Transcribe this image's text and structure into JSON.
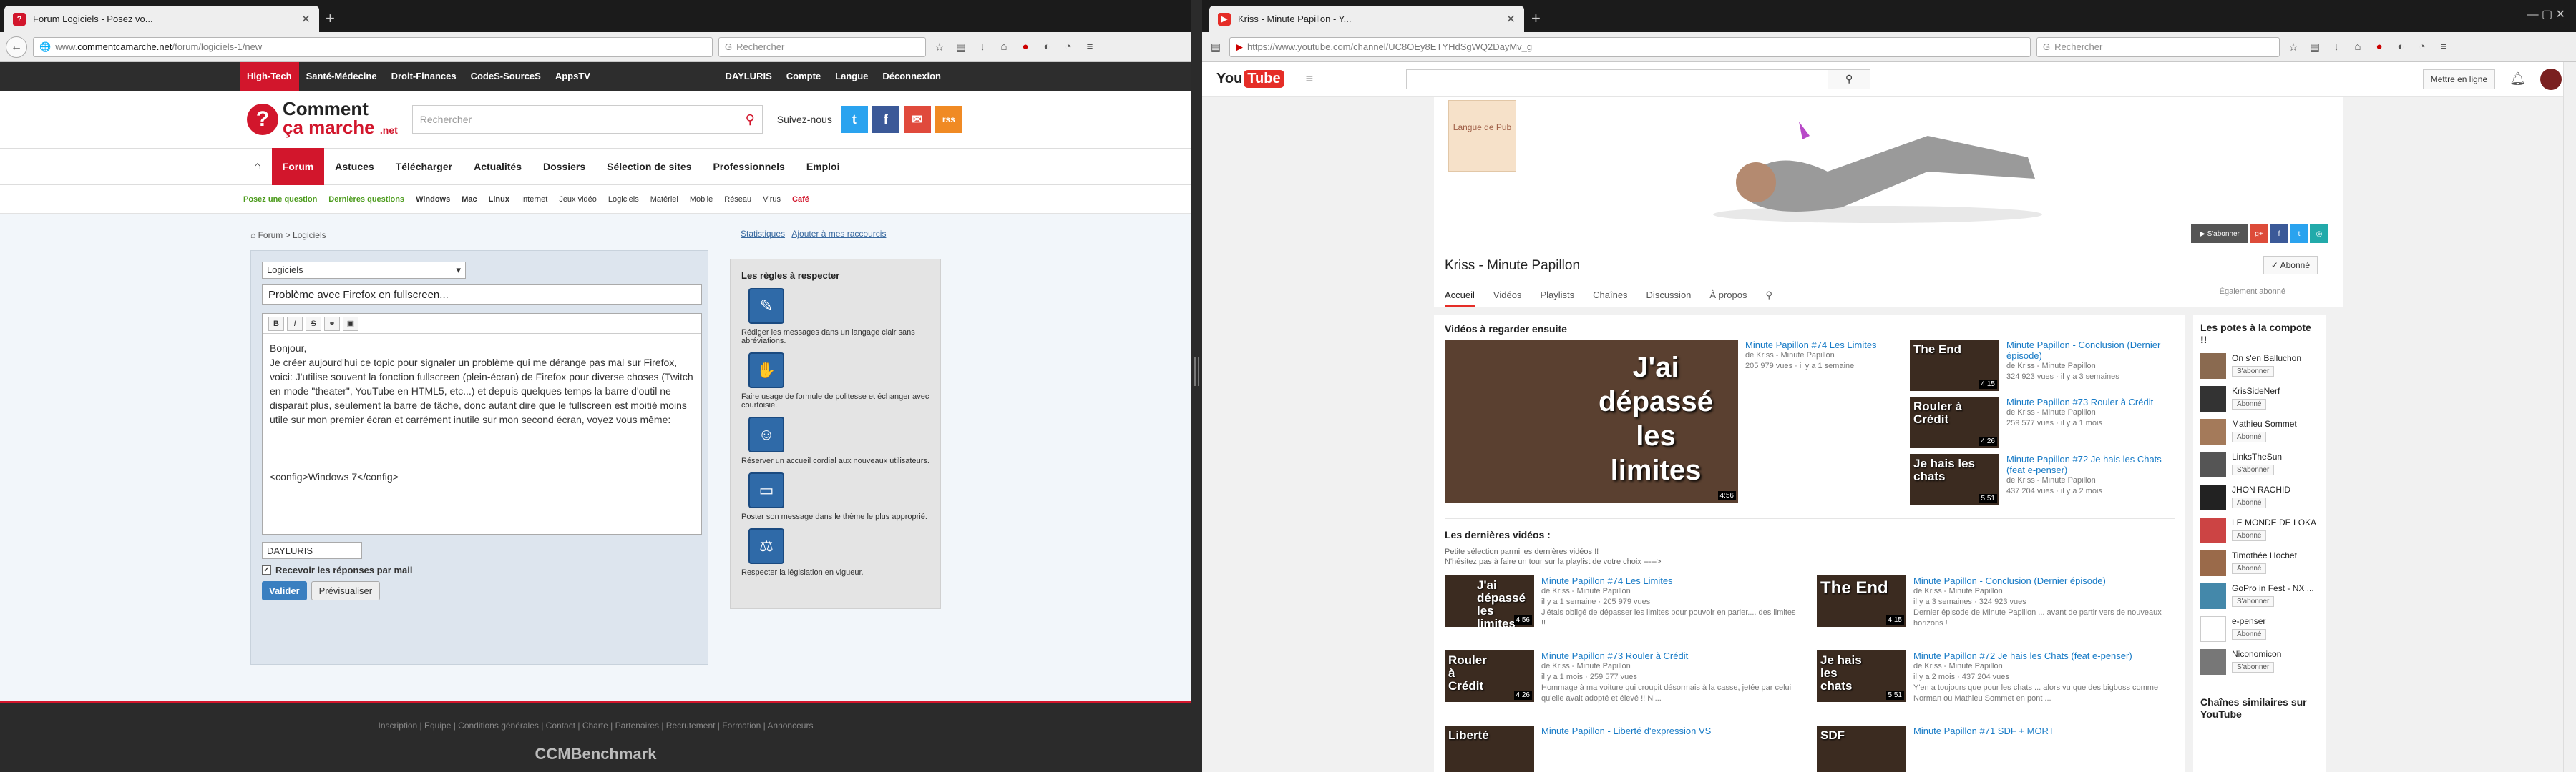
{
  "left": {
    "tab_title": "Forum Logiciels - Posez vo...",
    "url_prefix": "www.",
    "url_domain": "commentcamarche.net",
    "url_path": "/forum/logiciels-1/new",
    "search_placeholder": "Rechercher",
    "topnav": [
      "High-Tech",
      "Santé-Médecine",
      "Droit-Finances",
      "CodeS-SourceS",
      "AppsTV"
    ],
    "topnav_right": [
      "DAYLURIS",
      "Compte",
      "Langue",
      "Déconnexion"
    ],
    "logo_line1": "Comment",
    "logo_line2": "ça marche",
    "logo_net": ".net",
    "site_search_placeholder": "Rechercher",
    "follow": "Suivez-nous",
    "social": [
      "t",
      "f",
      "✉",
      "rss"
    ],
    "menu": [
      "Forum",
      "Astuces",
      "Télécharger",
      "Actualités",
      "Dossiers",
      "Sélection de sites",
      "Professionnels",
      "Emploi"
    ],
    "submenu": [
      "Posez une question",
      "Dernières questions",
      "Windows",
      "Mac",
      "Linux",
      "Internet",
      "Jeux vidéo",
      "Logiciels",
      "Matériel",
      "Mobile",
      "Réseau",
      "Virus",
      "Café"
    ],
    "breadcrumb": "Forum > Logiciels",
    "stats": "Statistiques",
    "add_shortcut": "Ajouter à mes raccourcis",
    "category": "Logiciels",
    "title_value": "Problème avec Firefox en fullscreen...",
    "editor_text": "Bonjour,\nJe créer aujourd'hui ce topic pour signaler un problème qui me dérange pas mal sur Firefox, voici: J'utilise souvent la fonction fullscreen (plein-écran) de Firefox pour diverse choses (Twitch en mode \"theater\", YouTube en HTML5, etc...) et depuis quelques temps la barre d'outil ne disparait plus, seulement la barre de tâche, donc autant dire que le fullscreen est moitié moins utile sur mon premier écran et carrément inutile sur mon second écran, voyez vous même:\n\n\n\n<config>Windows 7</config>",
    "pseudo": "DAYLURIS",
    "email_label": "Recevoir les réponses par mail",
    "submit": "Valider",
    "preview": "Prévisualiser",
    "rules_title": "Les règles à respecter",
    "rules": [
      "Rédiger les messages dans un langage clair sans abréviations.",
      "Faire usage de formule de politesse et échanger avec courtoisie.",
      "Réserver un accueil cordial aux nouveaux utilisateurs.",
      "Poster son message dans le thème le plus approprié.",
      "Respecter la législation en vigueur."
    ],
    "footer_links": "Inscription | Equipe | Conditions générales | Contact | Charte | Partenaires | Recrutement | Formation | Annonceurs",
    "footer_brand": "CCMBenchmark"
  },
  "right": {
    "tab_title": "Kriss - Minute Papillon - Y...",
    "url": "https://www.youtube.com/channel/UC8OEy8ETYHdSgWQ2DayMv_g",
    "search_placeholder": "Rechercher",
    "mettre_en_ligne": "Mettre en ligne",
    "logo_you": "You",
    "logo_tube": "Tube",
    "banner_logo": "Langue de Pub",
    "channel_name": "Kriss - Minute Papillon",
    "subscribed": "✓ Abonné",
    "tabs": [
      "Accueil",
      "Vidéos",
      "Playlists",
      "Chaînes",
      "Discussion",
      "À propos"
    ],
    "also_subscribed": "Également abonné",
    "sec1": "Vidéos à regarder ensuite",
    "featured": {
      "thumb_text": "J'ai dépassé les limites",
      "dur": "4:56",
      "title": "Minute Papillon #74 Les Limites",
      "by": "de Kriss - Minute Papillon",
      "meta": "205 979 vues · il y a 1 semaine"
    },
    "side_videos": [
      {
        "thumb": "The End",
        "dur": "4:15",
        "title": "Minute Papillon - Conclusion (Dernier épisode)",
        "by": "de Kriss - Minute Papillon",
        "meta": "324 923 vues · il y a 3 semaines"
      },
      {
        "thumb": "Rouler à Crédit",
        "dur": "4:26",
        "title": "Minute Papillon #73 Rouler à Crédit",
        "by": "de Kriss - Minute Papillon",
        "meta": "259 577 vues · il y a 1 mois"
      },
      {
        "thumb": "Je hais les chats",
        "dur": "5:51",
        "title": "Minute Papillon #72 Je hais les Chats (feat e-penser)",
        "by": "de Kriss - Minute Papillon",
        "meta": "437 204 vues · il y a 2 mois"
      }
    ],
    "sec2": "Les dernières vidéos :",
    "sec2_desc1": "Petite sélection parmi les dernières vidéos !!",
    "sec2_desc2": "N'hésitez pas à faire un tour sur la playlist de votre choix ----->",
    "latest": [
      {
        "thumb": "J'ai dépassé les limites",
        "dur": "4:56",
        "title": "Minute Papillon #74 Les Limites",
        "by": "de Kriss - Minute Papillon",
        "meta": "il y a 1 semaine · 205 979 vues",
        "desc": "J'étais obligé de dépasser les limites pour pouvoir en parler.... des limites !!"
      },
      {
        "thumb": "The End",
        "dur": "4:15",
        "title": "Minute Papillon - Conclusion (Dernier épisode)",
        "by": "de Kriss - Minute Papillon",
        "meta": "il y a 3 semaines · 324 923 vues",
        "desc": "Dernier épisode de Minute Papillon ... avant de partir vers de nouveaux horizons !"
      },
      {
        "thumb": "Rouler à Crédit",
        "dur": "4:26",
        "title": "Minute Papillon #73 Rouler à Crédit",
        "by": "de Kriss - Minute Papillon",
        "meta": "il y a 1 mois · 259 577 vues",
        "desc": "Hommage à ma voiture qui croupit désormais à la casse, jetée par celui qu'elle avait adopté et élevé !! Ni..."
      },
      {
        "thumb": "Je hais les chats",
        "dur": "5:51",
        "title": "Minute Papillon #72 Je hais les Chats (feat e-penser)",
        "by": "de Kriss - Minute Papillon",
        "meta": "il y a 2 mois · 437 204 vues",
        "desc": "Y'en a toujours que pour les chats ... alors vu que des bigboss comme Norman ou Mathieu Sommet en pont ..."
      },
      {
        "thumb": "Liberté",
        "title": "Minute Papillon - Liberté d'expression VS"
      },
      {
        "thumb": "SDF",
        "title": "Minute Papillon #71 SDF + MORT"
      }
    ],
    "side_title": "Les potes à la compote !!",
    "friends": [
      {
        "name": "On s'en Balluchon",
        "btn": "S'abonner"
      },
      {
        "name": "KrisSideNerf",
        "btn": "Abonné"
      },
      {
        "name": "Mathieu Sommet",
        "btn": "Abonné"
      },
      {
        "name": "LinksTheSun",
        "btn": "S'abonner"
      },
      {
        "name": "JHON RACHID",
        "btn": "Abonné"
      },
      {
        "name": "LE MONDE DE LOKA",
        "btn": "Abonné"
      },
      {
        "name": "Timothée Hochet",
        "btn": "Abonné"
      },
      {
        "name": "GoPro in Fest - NX ...",
        "btn": "S'abonner"
      },
      {
        "name": "e-penser",
        "btn": "Abonné"
      },
      {
        "name": "Niconomicon",
        "btn": "S'abonner"
      }
    ],
    "similar_title": "Chaînes similaires sur YouTube"
  }
}
